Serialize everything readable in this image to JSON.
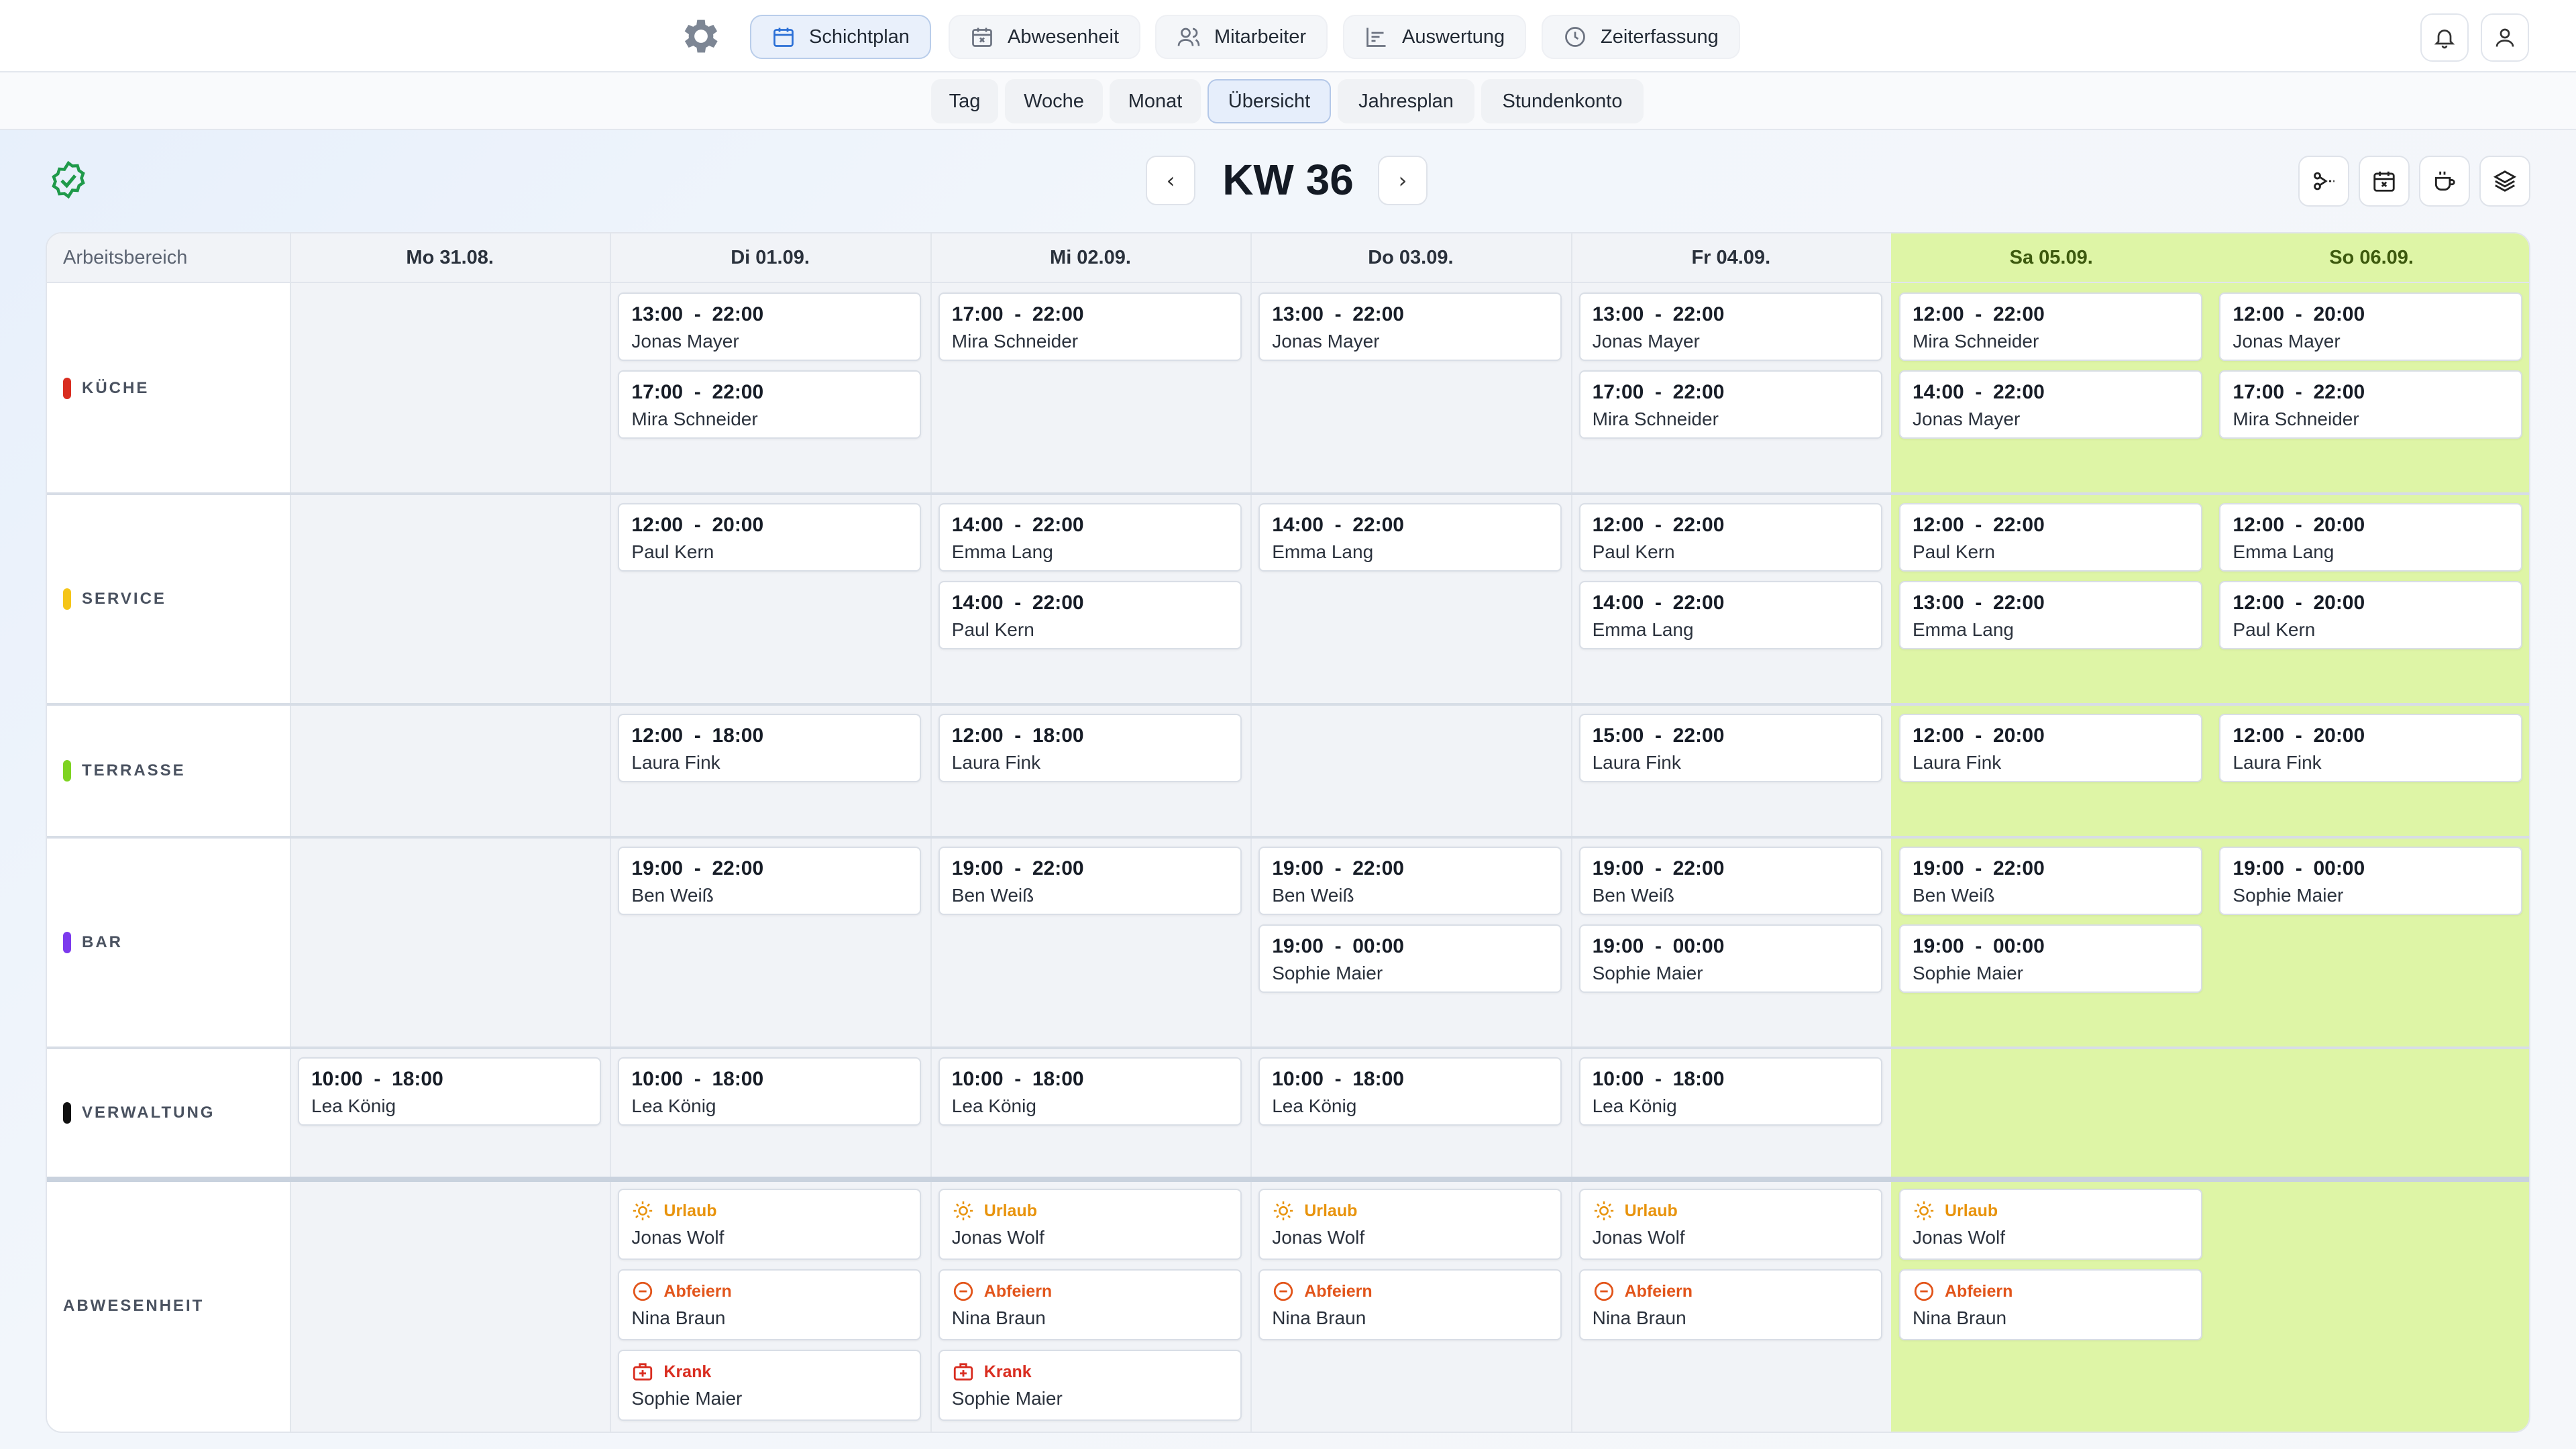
{
  "nav": {
    "items": [
      {
        "label": "Schichtplan",
        "icon": "calendar-icon",
        "active": true
      },
      {
        "label": "Abwesenheit",
        "icon": "calendar-x-icon",
        "active": false
      },
      {
        "label": "Mitarbeiter",
        "icon": "users-icon",
        "active": false
      },
      {
        "label": "Auswertung",
        "icon": "chart-icon",
        "active": false
      },
      {
        "label": "Zeiterfassung",
        "icon": "clock-icon",
        "active": false
      }
    ]
  },
  "subnav": {
    "tabs": [
      {
        "label": "Tag",
        "active": false
      },
      {
        "label": "Woche",
        "active": false
      },
      {
        "label": "Monat",
        "active": false
      },
      {
        "label": "Übersicht",
        "active": true
      },
      {
        "label": "Jahresplan",
        "active": false
      },
      {
        "label": "Stundenkonto",
        "active": false
      }
    ]
  },
  "week": {
    "title": "KW 36",
    "prev": "‹",
    "next": "›"
  },
  "grid": {
    "corner_label": "Arbeitsbereich",
    "days": [
      {
        "label": "Mo 31.08.",
        "weekend": false
      },
      {
        "label": "Di 01.09.",
        "weekend": false
      },
      {
        "label": "Mi 02.09.",
        "weekend": false
      },
      {
        "label": "Do 03.09.",
        "weekend": false
      },
      {
        "label": "Fr 04.09.",
        "weekend": false
      },
      {
        "label": "Sa 05.09.",
        "weekend": true
      },
      {
        "label": "So 06.09.",
        "weekend": true
      }
    ],
    "areas": [
      {
        "name": "KÜCHE",
        "color": "#d92d20"
      },
      {
        "name": "SERVICE",
        "color": "#f5c518"
      },
      {
        "name": "TERRASSE",
        "color": "#7ed321"
      },
      {
        "name": "BAR",
        "color": "#7c3aed"
      },
      {
        "name": "VERWALTUNG",
        "color": "#111111"
      }
    ],
    "absence_label": "ABWESENHEIT",
    "shifts": [
      [
        [],
        [
          {
            "time": "13:00  -  22:00",
            "name": "Jonas Mayer"
          },
          {
            "time": "17:00  -  22:00",
            "name": "Mira Schneider"
          }
        ],
        [
          {
            "time": "17:00  -  22:00",
            "name": "Mira Schneider"
          }
        ],
        [
          {
            "time": "13:00  -  22:00",
            "name": "Jonas Mayer"
          }
        ],
        [
          {
            "time": "13:00  -  22:00",
            "name": "Jonas Mayer"
          },
          {
            "time": "17:00  -  22:00",
            "name": "Mira Schneider"
          }
        ],
        [
          {
            "time": "12:00  -  22:00",
            "name": "Mira Schneider"
          },
          {
            "time": "14:00  -  22:00",
            "name": "Jonas Mayer"
          }
        ],
        [
          {
            "time": "12:00  -  20:00",
            "name": "Jonas Mayer"
          },
          {
            "time": "17:00  -  22:00",
            "name": "Mira Schneider"
          }
        ]
      ],
      [
        [],
        [
          {
            "time": "12:00  -  20:00",
            "name": "Paul Kern"
          }
        ],
        [
          {
            "time": "14:00  -  22:00",
            "name": "Emma Lang"
          },
          {
            "time": "14:00  -  22:00",
            "name": "Paul Kern"
          }
        ],
        [
          {
            "time": "14:00  -  22:00",
            "name": "Emma Lang"
          }
        ],
        [
          {
            "time": "12:00  -  22:00",
            "name": "Paul Kern"
          },
          {
            "time": "14:00  -  22:00",
            "name": "Emma Lang"
          }
        ],
        [
          {
            "time": "12:00  -  22:00",
            "name": "Paul Kern"
          },
          {
            "time": "13:00  -  22:00",
            "name": "Emma Lang"
          }
        ],
        [
          {
            "time": "12:00  -  20:00",
            "name": "Emma Lang"
          },
          {
            "time": "12:00  -  20:00",
            "name": "Paul Kern"
          }
        ]
      ],
      [
        [],
        [
          {
            "time": "12:00  -  18:00",
            "name": "Laura Fink"
          }
        ],
        [
          {
            "time": "12:00  -  18:00",
            "name": "Laura Fink"
          }
        ],
        [],
        [
          {
            "time": "15:00  -  22:00",
            "name": "Laura Fink"
          }
        ],
        [
          {
            "time": "12:00  -  20:00",
            "name": "Laura Fink"
          }
        ],
        [
          {
            "time": "12:00  -  20:00",
            "name": "Laura Fink"
          }
        ]
      ],
      [
        [],
        [
          {
            "time": "19:00  -  22:00",
            "name": "Ben Weiß"
          }
        ],
        [
          {
            "time": "19:00  -  22:00",
            "name": "Ben Weiß"
          }
        ],
        [
          {
            "time": "19:00  -  22:00",
            "name": "Ben Weiß"
          },
          {
            "time": "19:00  -  00:00",
            "name": "Sophie Maier"
          }
        ],
        [
          {
            "time": "19:00  -  22:00",
            "name": "Ben Weiß"
          },
          {
            "time": "19:00  -  00:00",
            "name": "Sophie Maier"
          }
        ],
        [
          {
            "time": "19:00  -  22:00",
            "name": "Ben Weiß"
          },
          {
            "time": "19:00  -  00:00",
            "name": "Sophie Maier"
          }
        ],
        [
          {
            "time": "19:00  -  00:00",
            "name": "Sophie Maier"
          }
        ]
      ],
      [
        [
          {
            "time": "10:00  -  18:00",
            "name": "Lea König"
          }
        ],
        [
          {
            "time": "10:00  -  18:00",
            "name": "Lea König"
          }
        ],
        [
          {
            "time": "10:00  -  18:00",
            "name": "Lea König"
          }
        ],
        [
          {
            "time": "10:00  -  18:00",
            "name": "Lea König"
          }
        ],
        [
          {
            "time": "10:00  -  18:00",
            "name": "Lea König"
          }
        ],
        [],
        []
      ]
    ],
    "absences": [
      [],
      [
        {
          "type": "Urlaub",
          "kind": "vacation",
          "name": "Jonas Wolf"
        },
        {
          "type": "Abfeiern",
          "kind": "timeoff",
          "name": "Nina Braun"
        },
        {
          "type": "Krank",
          "kind": "sick",
          "name": "Sophie Maier"
        }
      ],
      [
        {
          "type": "Urlaub",
          "kind": "vacation",
          "name": "Jonas Wolf"
        },
        {
          "type": "Abfeiern",
          "kind": "timeoff",
          "name": "Nina Braun"
        },
        {
          "type": "Krank",
          "kind": "sick",
          "name": "Sophie Maier"
        }
      ],
      [
        {
          "type": "Urlaub",
          "kind": "vacation",
          "name": "Jonas Wolf"
        },
        {
          "type": "Abfeiern",
          "kind": "timeoff",
          "name": "Nina Braun"
        }
      ],
      [
        {
          "type": "Urlaub",
          "kind": "vacation",
          "name": "Jonas Wolf"
        },
        {
          "type": "Abfeiern",
          "kind": "timeoff",
          "name": "Nina Braun"
        }
      ],
      [
        {
          "type": "Urlaub",
          "kind": "vacation",
          "name": "Jonas Wolf"
        },
        {
          "type": "Abfeiern",
          "kind": "timeoff",
          "name": "Nina Braun"
        }
      ],
      []
    ],
    "absence_colors": {
      "vacation": "#e8930c",
      "timeoff": "#e2551b",
      "sick": "#d92d20"
    }
  }
}
